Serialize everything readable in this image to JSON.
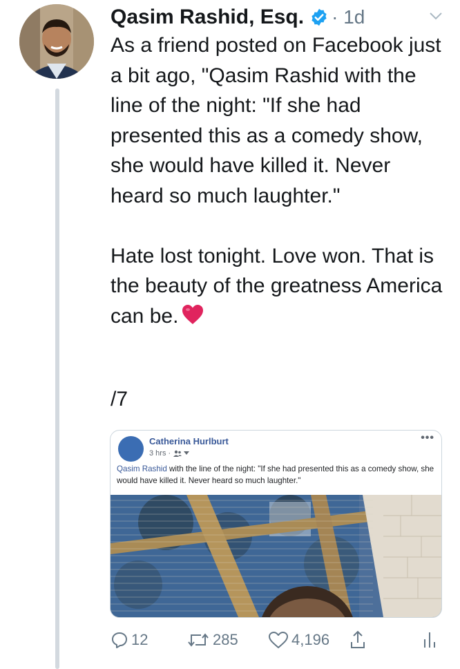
{
  "tweet": {
    "author_name": "Qasim Rashid, Esq.",
    "verified": true,
    "time": "· 1d",
    "paragraphs": [
      "As a friend posted on Facebook just a bit ago, \"Qasim Rashid with the line of the night: \"If she had presented this as a comedy show, she would have killed it. Never heard so much laughter.\"",
      "Hate lost tonight. Love won. That is the beauty of the greatness America can be."
    ],
    "thread_counter": "/7"
  },
  "embedded_post": {
    "author": "Catherina Hurlburt",
    "meta": "3 hrs ·",
    "mention": "Qasim Rashid",
    "text": " with the line of the night: \"If she had presented this as a comedy show, she would have killed it. Never heard so much laughter.\"",
    "menu": "•••"
  },
  "actions": {
    "replies": "12",
    "retweets": "285",
    "likes": "4,196"
  },
  "colors": {
    "text": "#14171a",
    "secondary": "#657786",
    "verified_blue": "#1da1f2",
    "fb_link": "#385898",
    "heart_red": "#e0245e"
  },
  "icons": [
    "verified-badge-icon",
    "caret-down-icon",
    "heart-emoji-icon",
    "reply-icon",
    "retweet-icon",
    "like-icon",
    "share-icon",
    "analytics-icon",
    "friends-icon",
    "dropdown-icon"
  ]
}
